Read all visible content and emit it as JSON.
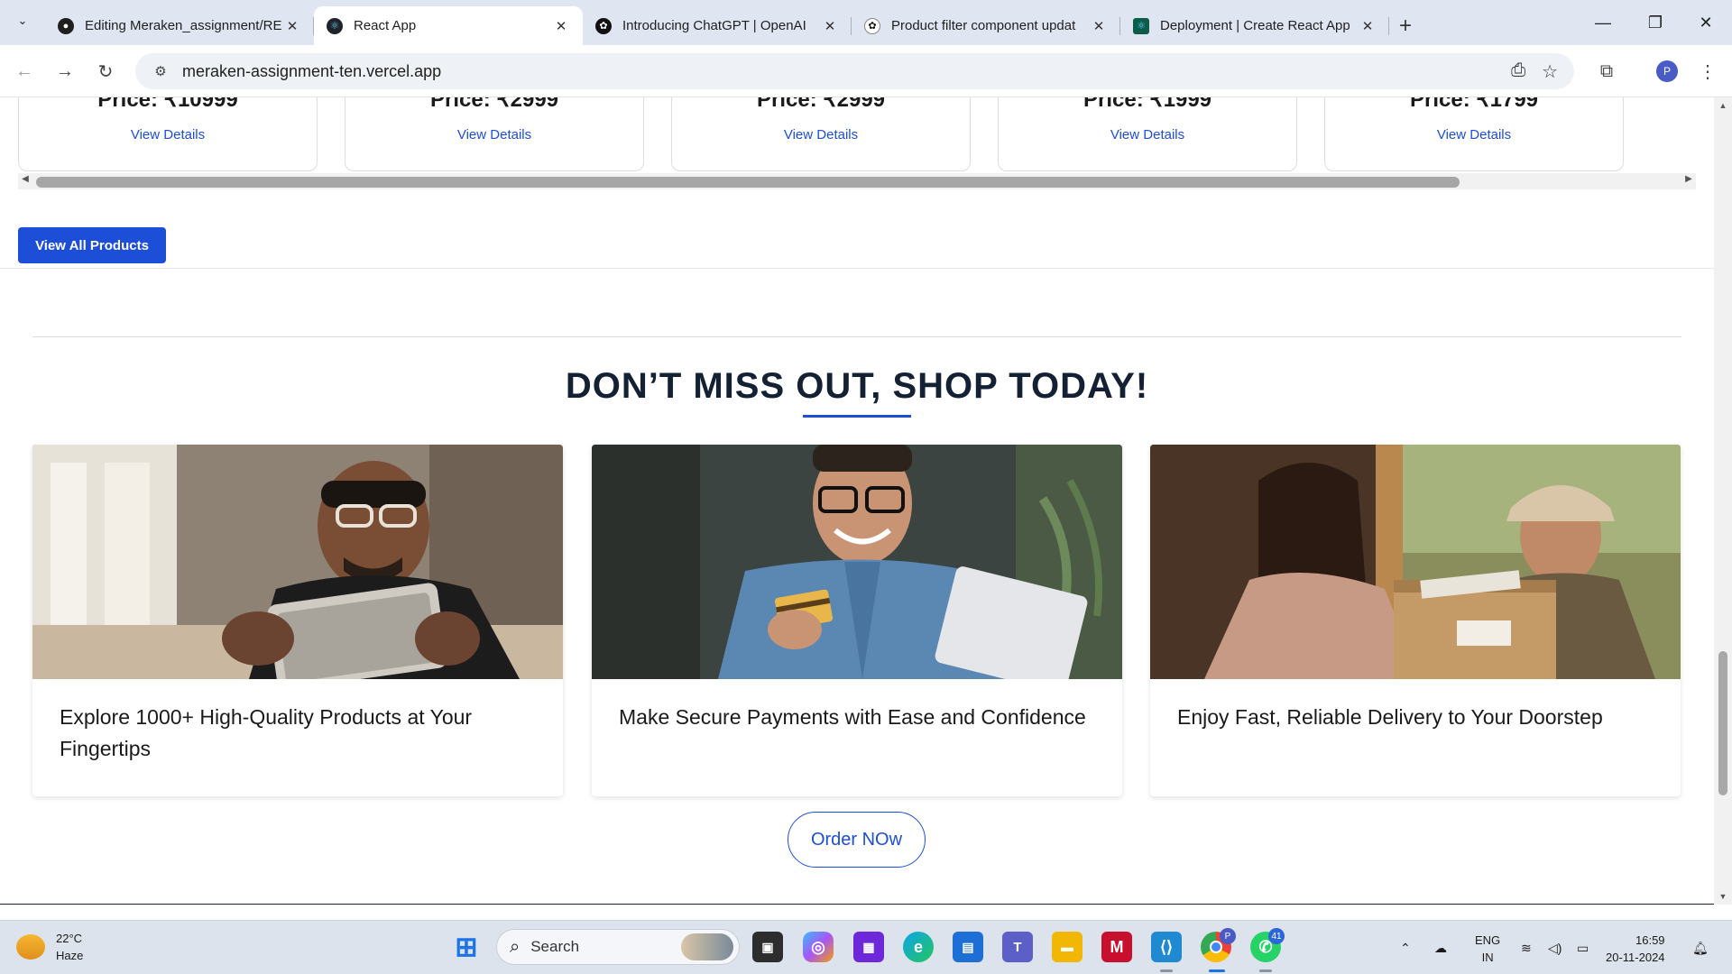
{
  "browser": {
    "tabs": [
      {
        "title": "Editing Meraken_assignment/RE",
        "icon": "github-icon"
      },
      {
        "title": "React App",
        "icon": "react-icon",
        "active": true
      },
      {
        "title": "Introducing ChatGPT | OpenAI",
        "icon": "openai-icon"
      },
      {
        "title": "Product filter component updat",
        "icon": "openai-icon"
      },
      {
        "title": "Deployment | Create React App",
        "icon": "react-icon"
      }
    ],
    "url": "meraken-assignment-ten.vercel.app",
    "profile_initial": "P"
  },
  "products": [
    {
      "price": "Price: ₹10999",
      "details_label": "View Details"
    },
    {
      "price": "Price: ₹2999",
      "details_label": "View Details"
    },
    {
      "price": "Price: ₹2999",
      "details_label": "View Details"
    },
    {
      "price": "Price: ₹1999",
      "details_label": "View Details"
    },
    {
      "price": "Price: ₹1799",
      "details_label": "View Details"
    }
  ],
  "view_all_label": "View All Products",
  "promo": {
    "heading": "DON’T MISS OUT, SHOP TODAY!",
    "cards": [
      {
        "caption": "Explore 1000+ High-Quality Products at Your Fingertips",
        "image": "man-with-tablet"
      },
      {
        "caption": "Make Secure Payments with Ease and Confidence",
        "image": "man-with-credit-card"
      },
      {
        "caption": "Enjoy Fast, Reliable Delivery to Your Doorstep",
        "image": "package-delivery"
      }
    ],
    "order_label": "Order NOw"
  },
  "taskbar": {
    "weather_temp": "22°C",
    "weather_desc": "Haze",
    "search_label": "Search",
    "lang_top": "ENG",
    "lang_bottom": "IN",
    "time": "16:59",
    "date": "20-11-2024",
    "whatsapp_badge": "41",
    "chrome_badge": "P"
  },
  "colors": {
    "accent": "#1d4ed8",
    "heading": "#142033",
    "footer": "#1b2333"
  }
}
